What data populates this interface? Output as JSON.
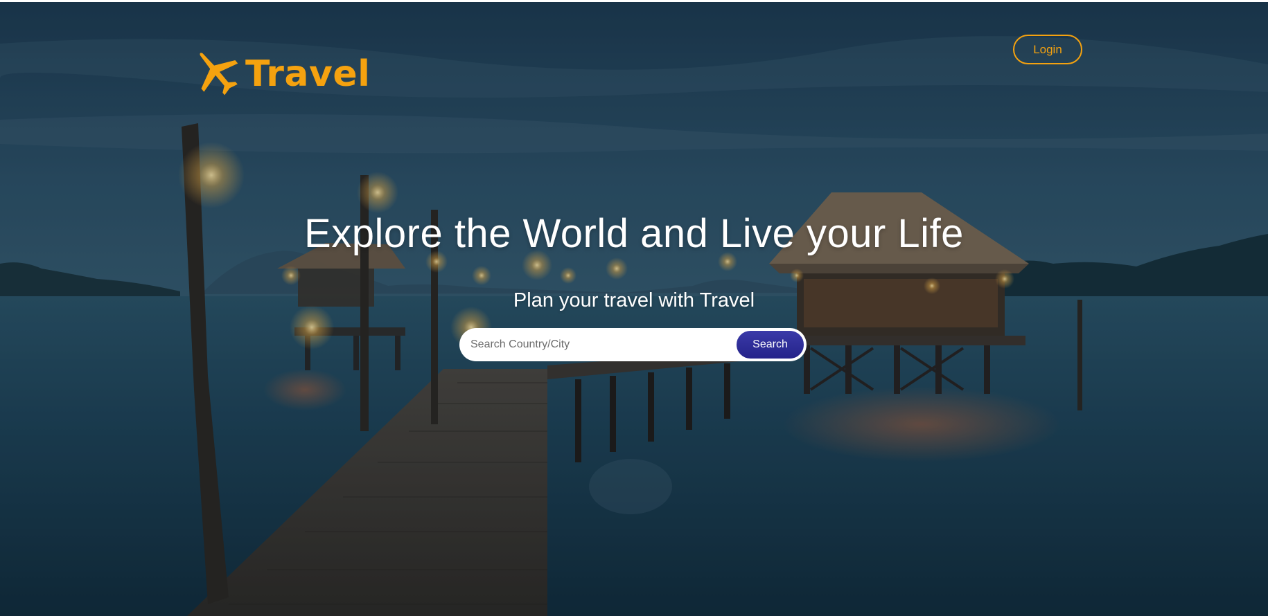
{
  "brand": {
    "name": "Travel",
    "icon": "airplane-icon",
    "color": "#f5a20f"
  },
  "nav": {
    "login_label": "Login"
  },
  "hero": {
    "title": "Explore the World and Live your Life",
    "subtitle": "Plan your travel with Travel",
    "background": "photo of a wooden pier at dusk leading to thatched-roof huts over the water"
  },
  "search": {
    "placeholder": "Search Country/City",
    "value": "",
    "button_label": "Search",
    "button_color": "#2d2b96"
  }
}
